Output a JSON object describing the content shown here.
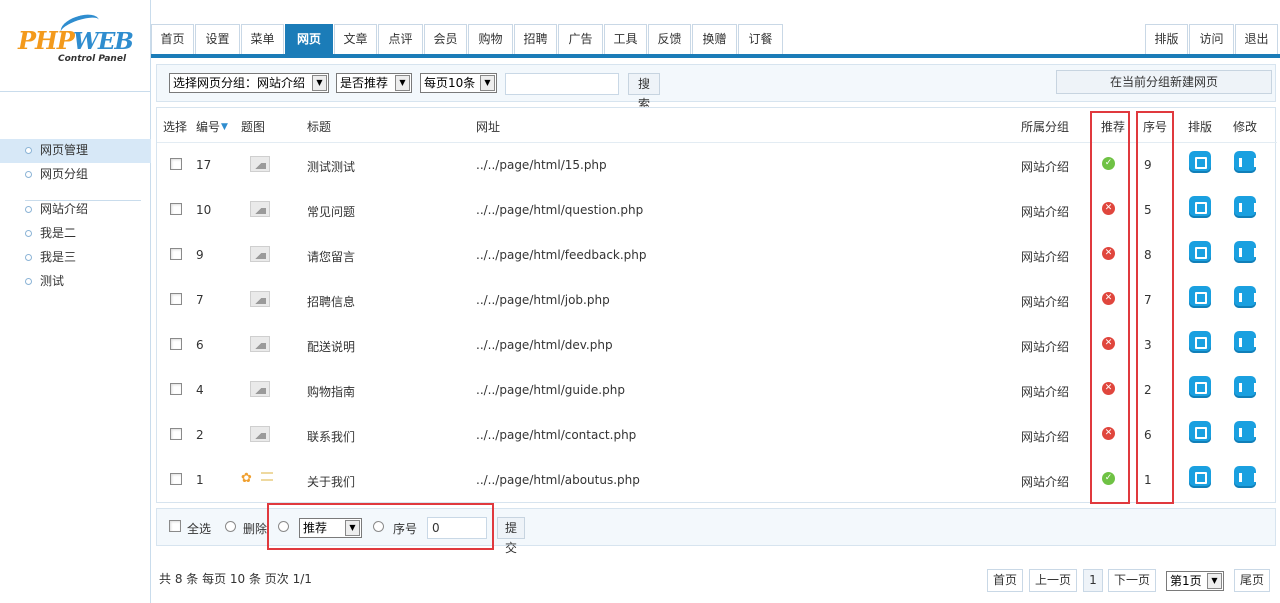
{
  "logo": {
    "php": "PHP",
    "web": "WEB",
    "subtitle": "Control Panel"
  },
  "top_tabs": [
    "首页",
    "设置",
    "菜单",
    "网页",
    "文章",
    "点评",
    "会员",
    "购物",
    "招聘",
    "广告",
    "工具",
    "反馈",
    "换赠",
    "订餐"
  ],
  "top_active_tab": "网页",
  "top_right": [
    "排版",
    "访问",
    "退出"
  ],
  "sidebar": {
    "group1": [
      "网页管理",
      "网页分组"
    ],
    "group2": [
      "网站介绍",
      "我是二",
      "我是三",
      "测试"
    ]
  },
  "filters": {
    "group_select": "选择网页分组：网站介绍",
    "recommend_select": "是否推荐",
    "per_page_select": "每页10条",
    "search_value": "",
    "search_button": "搜索",
    "new_button": "在当前分组新建网页"
  },
  "table": {
    "headers": {
      "select": "选择",
      "id": "编号",
      "thumb": "题图",
      "title": "标题",
      "url": "网址",
      "group": "所属分组",
      "recommend": "推荐",
      "order": "序号",
      "layout": "排版",
      "edit": "修改"
    },
    "rows": [
      {
        "id": "17",
        "title": "测试测试",
        "url": "../../page/html/15.php",
        "group": "网站介绍",
        "recommended": true,
        "order": "9"
      },
      {
        "id": "10",
        "title": "常见问题",
        "url": "../../page/html/question.php",
        "group": "网站介绍",
        "recommended": false,
        "order": "5"
      },
      {
        "id": "9",
        "title": "请您留言",
        "url": "../../page/html/feedback.php",
        "group": "网站介绍",
        "recommended": false,
        "order": "8"
      },
      {
        "id": "7",
        "title": "招聘信息",
        "url": "../../page/html/job.php",
        "group": "网站介绍",
        "recommended": false,
        "order": "7"
      },
      {
        "id": "6",
        "title": "配送说明",
        "url": "../../page/html/dev.php",
        "group": "网站介绍",
        "recommended": false,
        "order": "3"
      },
      {
        "id": "4",
        "title": "购物指南",
        "url": "../../page/html/guide.php",
        "group": "网站介绍",
        "recommended": false,
        "order": "2"
      },
      {
        "id": "2",
        "title": "联系我们",
        "url": "../../page/html/contact.php",
        "group": "网站介绍",
        "recommended": false,
        "order": "6"
      },
      {
        "id": "1",
        "title": "关于我们",
        "url": "../../page/html/aboutus.php",
        "group": "网站介绍",
        "recommended": true,
        "order": "1"
      }
    ]
  },
  "actions": {
    "select_all": "全选",
    "delete": "删除",
    "recommend_select": "推荐",
    "order_label": "序号",
    "order_value": "0",
    "submit": "提交"
  },
  "footer": {
    "info": "共 8 条 每页 10 条 页次 1/1",
    "first": "首页",
    "prev": "上一页",
    "current_page": "1",
    "next": "下一页",
    "page_select": "第1页",
    "last": "尾页"
  },
  "colors": {
    "accent": "#1b7cb8",
    "highlight": "#e0393e",
    "ok": "#6fc244",
    "no": "#e0463d"
  }
}
